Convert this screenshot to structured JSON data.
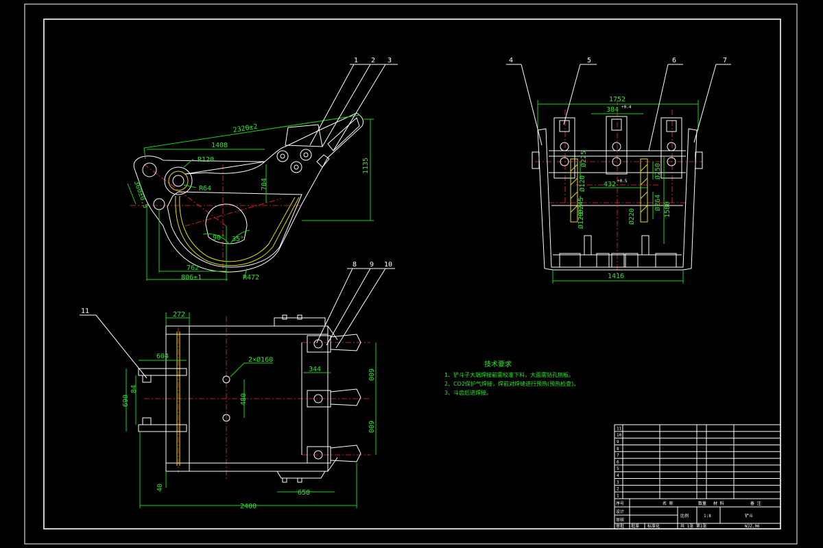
{
  "drawing": {
    "side_view": {
      "callouts": [
        "1",
        "2",
        "3"
      ],
      "dims": [
        "2320±2",
        "1408",
        "R120",
        "R64",
        "360±0.5",
        "704",
        "1135",
        "762",
        "806±1",
        "R472",
        "90°",
        "35°"
      ]
    },
    "rear_view": {
      "callouts": [
        "4",
        "5",
        "6",
        "7"
      ],
      "dims": [
        "1752",
        "384",
        "+0.4",
        "1416",
        "432",
        "+0.5",
        "Ø225",
        "Ø120",
        "Ø250",
        "Ø245",
        "Ø264",
        "Ø120",
        "Ø220",
        "1580"
      ]
    },
    "plan_view": {
      "callouts": [
        "8",
        "9",
        "10",
        "11"
      ],
      "dims": [
        "272",
        "604",
        "690",
        "84",
        "2×Ø160",
        "344",
        "480",
        "600",
        "600",
        "40",
        "658",
        "2400"
      ]
    },
    "notes": {
      "title": "技术要求",
      "items": [
        "1、铲斗子大端焊接前需校准下料，大面需钻孔刨板。",
        "2、CO2保护气焊接，焊前对焊缝进行预热(预热检查)。",
        "3、斗齿后进焊接。"
      ]
    },
    "title_block": {
      "row_numbers": [
        "11",
        "10",
        "9",
        "8",
        "7",
        "6",
        "5",
        "4",
        "3",
        "2",
        "1"
      ],
      "header": [
        "序号",
        "名 称",
        "数量",
        "材 料",
        "备 注"
      ],
      "left_labels": [
        "设计",
        "审核",
        "审批",
        "批准"
      ],
      "scale_label": "比例",
      "scale": "1:8",
      "part_name": "铲斗",
      "sheet_label": "共 1张 第1张",
      "drawing_no": "WJZ.06",
      "footer_label": "标准化"
    }
  }
}
